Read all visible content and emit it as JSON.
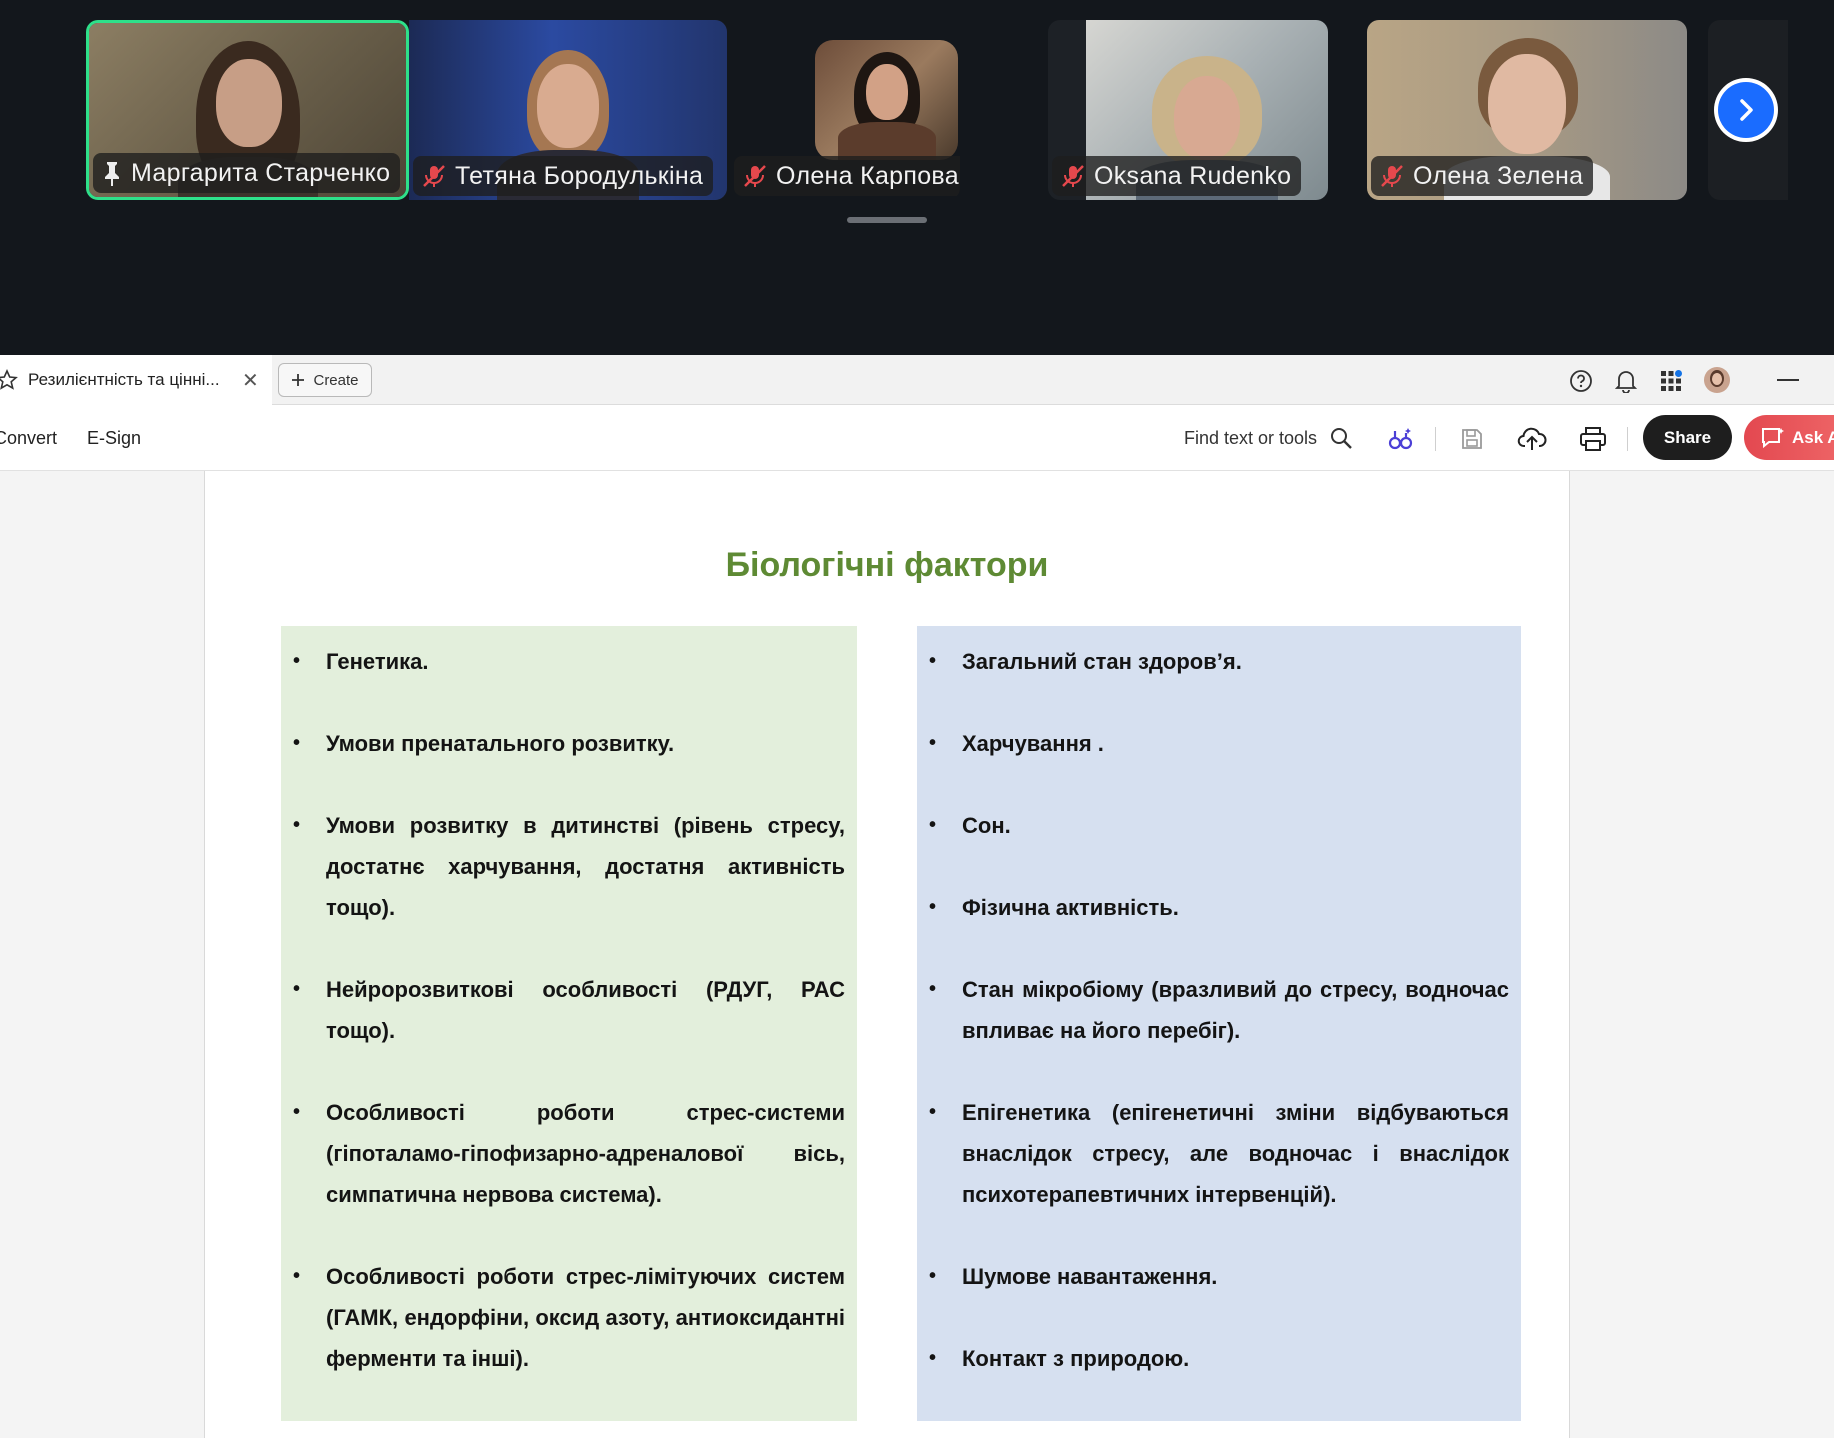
{
  "video_strip": {
    "participants": [
      {
        "name": "Маргарита Старченко",
        "active": true,
        "status_icon": "pin-icon"
      },
      {
        "name": "Тетяна Бородулькіна",
        "active": false,
        "status_icon": "mic-off-icon"
      },
      {
        "name": "Олена Карпова",
        "active": false,
        "status_icon": "mic-off-icon"
      },
      {
        "name": "Oksana Rudenko",
        "active": false,
        "status_icon": "mic-off-icon"
      },
      {
        "name": "Олена Зелена",
        "active": false,
        "status_icon": "mic-off-icon"
      }
    ],
    "next_button_icon": "chevron-right-icon",
    "colors": {
      "active_border": "#2ee08a",
      "next_button": "#1a6cff"
    }
  },
  "tab_bar": {
    "doc_tab_title": "Резилієнтність та цінні...",
    "create_label": "Create"
  },
  "toolbar": {
    "convert_label": "Convert",
    "esign_label": "E-Sign",
    "find_placeholder": "Find text or tools",
    "share_label": "Share",
    "ask_ai_label": "Ask AI"
  },
  "slide": {
    "title": "Біологічні фактори",
    "left_items": [
      "Генетика.",
      "Умови пренатального розвитку.",
      "Умови розвитку в дитинстві (рівень стресу, достатнє харчування, достатня активність тощо).",
      "Нейророзвиткові особливості (РДУГ, РАС тощо).",
      "Особливості роботи стрес-системи (гіпоталамо-гіпофизарно-адреналової вісь, симпатична нервова система).",
      "Особливості роботи стрес-лімітуючих систем (ГАМК, ендорфіни, оксид азоту, антиоксидантні ферменти та інші)."
    ],
    "right_items": [
      "Загальний  стан здоров’я.",
      "Харчування .",
      "Сон.",
      "Фізична активність.",
      "Стан мікробіому (вразливий до стресу, водночас впливає на його перебіг).",
      "Епігенетика  (епігенетичні зміни відбуваються внаслідок стресу, але водночас і внаслідок психотерапевтичних інтервенцій).",
      "Шумове навантаження.",
      "Контакт з природою."
    ],
    "colors": {
      "title": "#5e8a34",
      "left_bg": "#e3efdc",
      "right_bg": "#d6e0f0"
    }
  }
}
